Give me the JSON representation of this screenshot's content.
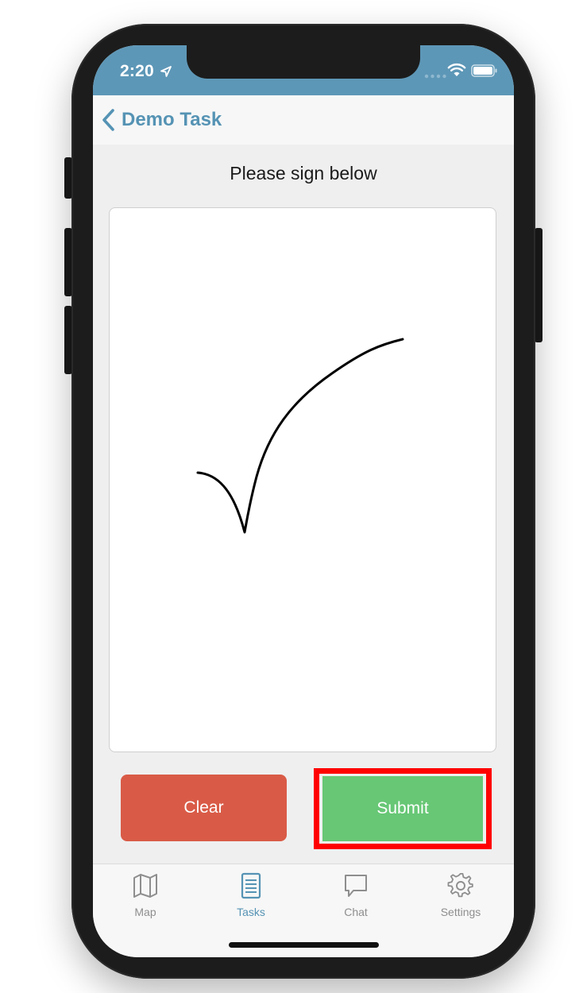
{
  "status_bar": {
    "time": "2:20",
    "background": "#5d97b7"
  },
  "nav": {
    "back_title": "Demo Task",
    "accent": "#5593b4"
  },
  "content": {
    "prompt": "Please sign below"
  },
  "buttons": {
    "clear_label": "Clear",
    "clear_color": "#d95b47",
    "submit_label": "Submit",
    "submit_color": "#67c775",
    "highlight_color": "#ff0000"
  },
  "tabs": [
    {
      "label": "Map",
      "icon": "map-icon",
      "active": false
    },
    {
      "label": "Tasks",
      "icon": "document-list-icon",
      "active": true
    },
    {
      "label": "Chat",
      "icon": "chat-bubble-icon",
      "active": false
    },
    {
      "label": "Settings",
      "icon": "gear-icon",
      "active": false
    }
  ]
}
